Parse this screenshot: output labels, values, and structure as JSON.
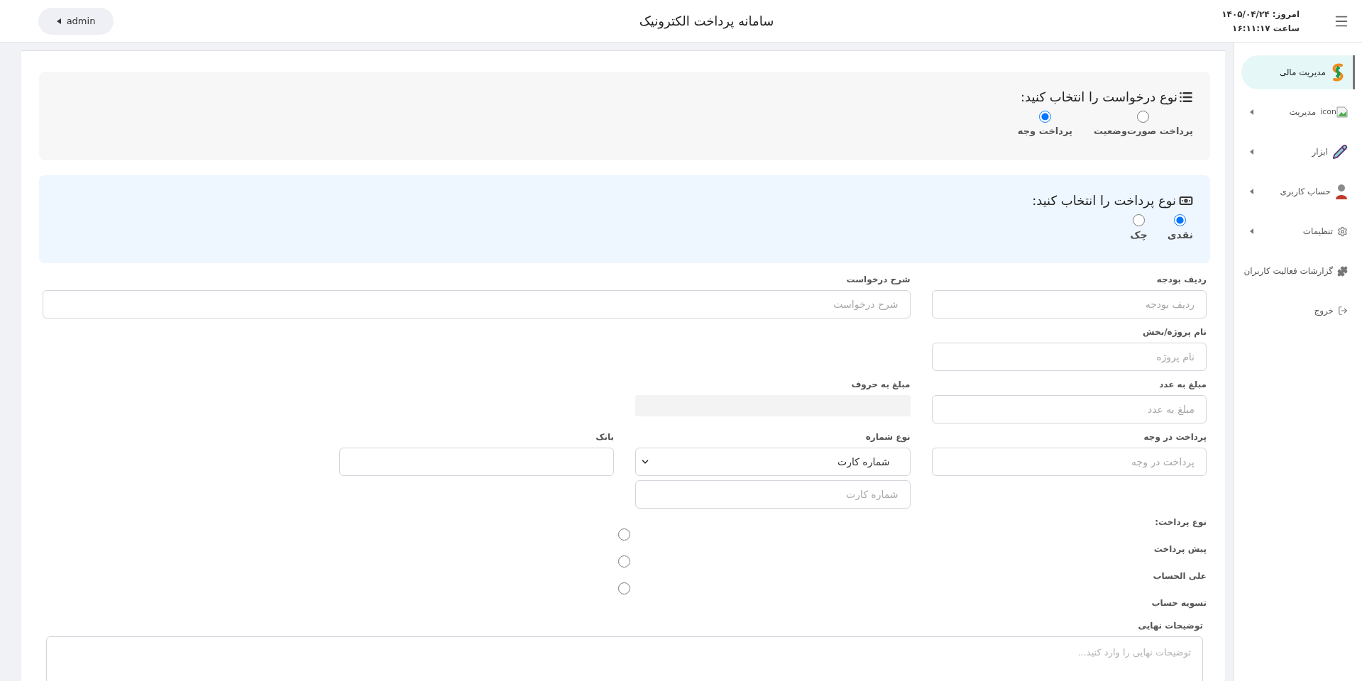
{
  "header": {
    "date": "امروز: ۱۴۰۵/۰۴/۲۴",
    "time": "ساعت ۱۶:۱۱:۱۷",
    "title": "سامانه پرداخت الکترونیک",
    "user": "admin"
  },
  "sidebar": {
    "items": [
      {
        "label": "مدیریت مالی",
        "selected": true,
        "has_submenu": false
      },
      {
        "label": "مدیریت",
        "image_alt": "icon",
        "selected": false,
        "has_submenu": true
      },
      {
        "label": "ابزار",
        "selected": false,
        "has_submenu": true
      },
      {
        "label": "حساب کاربری",
        "selected": false,
        "has_submenu": true
      },
      {
        "label": "تنظیمات",
        "selected": false,
        "has_submenu": true
      },
      {
        "label": "گزارشات فعالیت کاربران",
        "selected": false,
        "has_submenu": false
      },
      {
        "label": "خروج",
        "selected": false,
        "has_submenu": false
      }
    ]
  },
  "request_type": {
    "title": "نوع درخواست را انتخاب کنید:",
    "options": [
      {
        "label": "پرداخت صورت‌وضعیت",
        "selected": false
      },
      {
        "label": "پرداخت وجه",
        "selected": true
      }
    ]
  },
  "payment_type": {
    "title": "نوع پرداخت را انتخاب کنید:",
    "options": [
      {
        "label": "نقدی",
        "selected": true
      },
      {
        "label": "چک",
        "selected": false
      }
    ]
  },
  "fields": {
    "budget_line": {
      "label": "ردیف بودجه",
      "placeholder": "ردیف بودجه"
    },
    "description": {
      "label": "شرح درخواست",
      "placeholder": "شرح درخواست"
    },
    "project": {
      "label": "نام پروژه/بخش",
      "placeholder": "نام پروژه"
    },
    "amount_digits": {
      "label": "مبلغ به عدد",
      "placeholder": "مبلغ به عدد"
    },
    "amount_words": {
      "label": "مبلغ به حروف",
      "disabled": true
    },
    "payee": {
      "label": "پرداخت در وجه",
      "placeholder": "پرداخت در وجه"
    },
    "number_type": {
      "label": "نوع شماره",
      "value": "شماره کارت"
    },
    "number": {
      "placeholder": "شماره کارت"
    },
    "bank": {
      "label": "بانک"
    }
  },
  "payment_kind": {
    "label": "نوع پرداخت:",
    "options": [
      {
        "label": "پیش پرداخت",
        "selected": false
      },
      {
        "label": "علی الحساب",
        "selected": false
      },
      {
        "label": "تسویه حساب",
        "selected": false
      }
    ]
  },
  "final_notes": {
    "label": "توضیحات نهایی",
    "placeholder": "توضیحات نهایی را وارد کنید..."
  }
}
